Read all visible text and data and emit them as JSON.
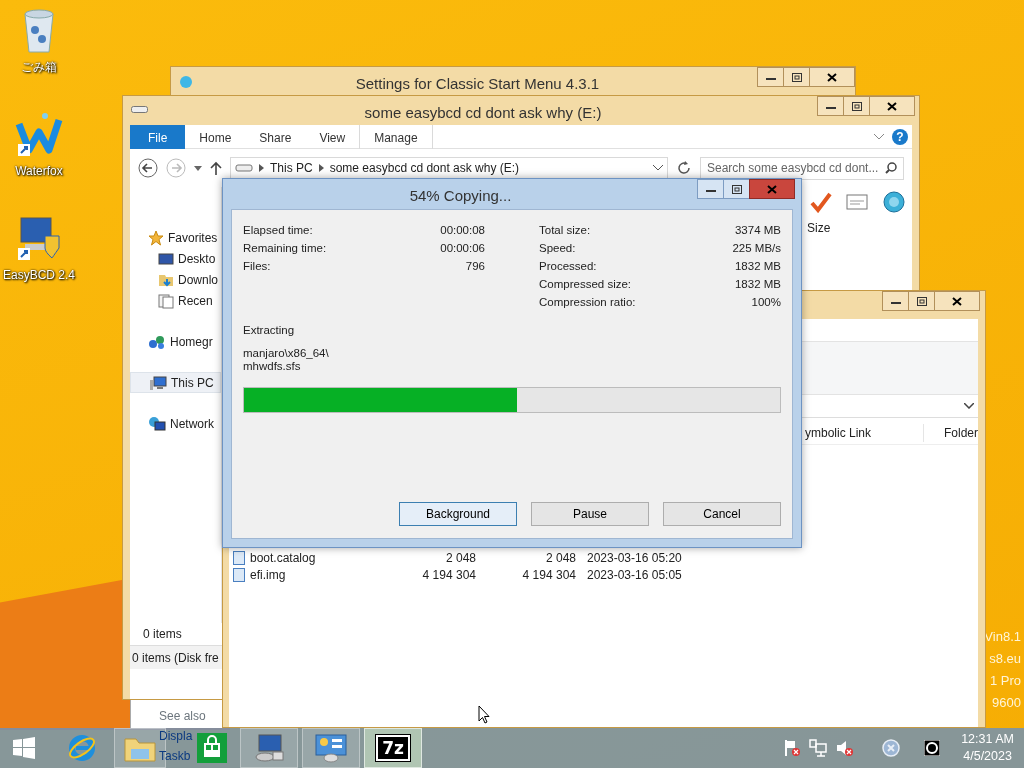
{
  "desktop": {
    "icons": [
      {
        "kind": "recycle_bin",
        "label": "ごみ箱"
      },
      {
        "kind": "waterfox",
        "label": "Waterfox"
      },
      {
        "kind": "easybcd",
        "label": "EasyBCD 2.4"
      }
    ],
    "build_info_lines": [
      "Vin8.1",
      "s8.eu",
      "1 Pro",
      "9600"
    ]
  },
  "settings_window": {
    "title": "Settings for Classic Start Menu 4.3.1"
  },
  "explorer": {
    "title": "some easybcd cd dont ask why (E:)",
    "ribbon_tabs": [
      {
        "label": "File",
        "kind": "file"
      },
      {
        "label": "Home",
        "kind": "tab"
      },
      {
        "label": "Share",
        "kind": "tab"
      },
      {
        "label": "View",
        "kind": "tab"
      },
      {
        "label": "Manage",
        "kind": "contextual"
      }
    ],
    "help_glyph": "?",
    "address_segments": [
      "This PC",
      "some easybcd cd dont ask why (E:)"
    ],
    "search": {
      "placeholder": "Search some easybcd cd dont..."
    },
    "nav_items": [
      {
        "label": "Favorites",
        "kind": "star",
        "selected": false,
        "children": [
          {
            "label": "Deskto",
            "kind": "desktop",
            "selected": false
          },
          {
            "label": "Downlo",
            "kind": "downloads",
            "selected": false
          },
          {
            "label": "Recen",
            "kind": "recent",
            "selected": false
          }
        ]
      },
      {
        "label": "Homegr",
        "kind": "homegroup",
        "selected": false
      },
      {
        "label": "This PC",
        "kind": "pc",
        "selected": true
      },
      {
        "label": "Network",
        "kind": "network",
        "selected": false
      }
    ],
    "column_header": "Size",
    "status": "0 items",
    "details": "0 items (Disk fre"
  },
  "back_window": {
    "see_also": "See also",
    "links": [
      "Displa",
      "Taskb"
    ]
  },
  "files_window": {
    "columns": [
      "ymbolic Link",
      "Folder"
    ],
    "rows": [
      {
        "name": "boot.catalog",
        "size": "2 048",
        "packed": "2 048",
        "modified": "2023-03-16 05:20"
      },
      {
        "name": "efi.img",
        "size": "4 194 304",
        "packed": "4 194 304",
        "modified": "2023-03-16 05:05"
      }
    ]
  },
  "copy_dialog": {
    "title": "54% Copying...",
    "stats_left": [
      {
        "label": "Elapsed time:",
        "value": "00:00:08"
      },
      {
        "label": "Remaining time:",
        "value": "00:00:06"
      },
      {
        "label": "Files:",
        "value": "796"
      }
    ],
    "stats_right": [
      {
        "label": "Total size:",
        "value": "3374 MB"
      },
      {
        "label": "Speed:",
        "value": "225 MB/s"
      },
      {
        "label": "Processed:",
        "value": "1832 MB"
      },
      {
        "label": "Compressed size:",
        "value": "1832 MB"
      },
      {
        "label": "Compression ratio:",
        "value": "100%"
      }
    ],
    "operation": "Extracting",
    "path_lines": [
      "manjaro\\x86_64\\",
      "mhwdfs.sfs"
    ],
    "progress": {
      "level": 0.51
    },
    "buttons": [
      {
        "label": "Background",
        "focused": true
      },
      {
        "label": "Pause",
        "focused": false
      },
      {
        "label": "Cancel",
        "focused": false
      }
    ]
  },
  "taskbar": {
    "apps": [
      {
        "kind": "start",
        "running": false,
        "active": false
      },
      {
        "kind": "browser",
        "running": false,
        "active": false
      },
      {
        "kind": "explorer",
        "running": true,
        "active": false
      },
      {
        "kind": "store",
        "running": false,
        "active": false
      },
      {
        "kind": "easybcd",
        "running": true,
        "active": false
      },
      {
        "kind": "control_panel",
        "running": true,
        "active": false
      },
      {
        "kind": "archiver",
        "label": "7z",
        "running": true,
        "active": true
      }
    ],
    "clock": {
      "time": "12:31 AM",
      "date": "4/5/2023"
    }
  }
}
